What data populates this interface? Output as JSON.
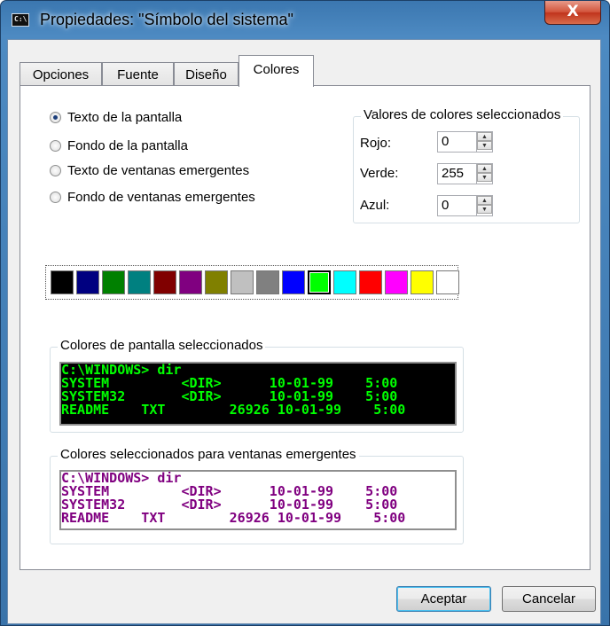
{
  "window": {
    "title": "Propiedades: \"Símbolo del sistema\"",
    "close_label": "X",
    "app_icon_text": "C:\\"
  },
  "tabs": [
    {
      "label": "Opciones"
    },
    {
      "label": "Fuente"
    },
    {
      "label": "Diseño"
    },
    {
      "label": "Colores",
      "active": true
    }
  ],
  "radios": [
    {
      "label": "Texto de la pantalla",
      "checked": true
    },
    {
      "label": "Fondo de la pantalla",
      "checked": false
    },
    {
      "label": "Texto de ventanas emergentes",
      "checked": false
    },
    {
      "label": "Fondo de ventanas emergentes",
      "checked": false
    }
  ],
  "color_values": {
    "legend": "Valores de colores seleccionados",
    "red_label": "Rojo:",
    "red": "0",
    "green_label": "Verde:",
    "green": "255",
    "blue_label": "Azul:",
    "blue": "0"
  },
  "palette": [
    "#000000",
    "#000080",
    "#008000",
    "#008080",
    "#800000",
    "#800080",
    "#808000",
    "#c0c0c0",
    "#808080",
    "#0000ff",
    "#00ff00",
    "#00ffff",
    "#ff0000",
    "#ff00ff",
    "#ffff00",
    "#ffffff"
  ],
  "palette_selected_index": 10,
  "screen_preview": {
    "legend": "Colores de pantalla seleccionados",
    "text_color": "#00ff00",
    "bg_color": "#000000",
    "lines": [
      "C:\\WINDOWS> dir",
      "SYSTEM         <DIR>      10-01-99    5:00",
      "SYSTEM32       <DIR>      10-01-99    5:00",
      "README    TXT        26926 10-01-99    5:00"
    ]
  },
  "popup_preview": {
    "legend": "Colores seleccionados para ventanas emergentes",
    "text_color": "#800080",
    "bg_color": "#ffffff",
    "lines": [
      "C:\\WINDOWS> dir",
      "SYSTEM         <DIR>      10-01-99    5:00",
      "SYSTEM32       <DIR>      10-01-99    5:00",
      "README    TXT        26926 10-01-99    5:00"
    ]
  },
  "buttons": {
    "ok": "Aceptar",
    "cancel": "Cancelar"
  }
}
